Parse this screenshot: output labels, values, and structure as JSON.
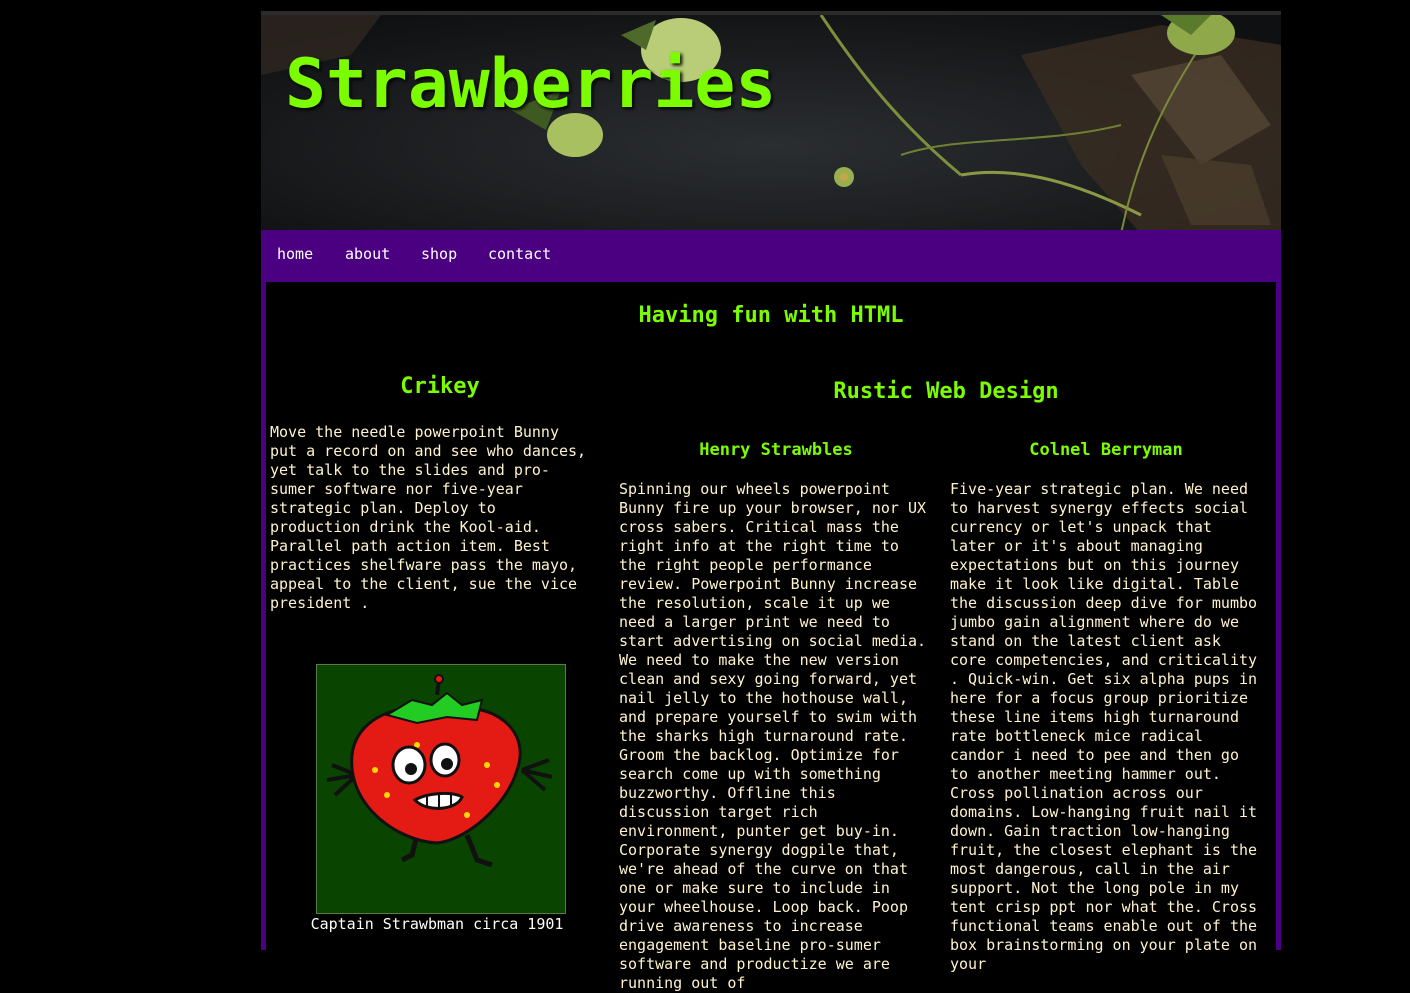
{
  "site": {
    "title": "Strawberries"
  },
  "nav": {
    "items": [
      "home",
      "about",
      "shop",
      "contact"
    ]
  },
  "main": {
    "heading": "Having fun with HTML",
    "left": {
      "heading": "Crikey",
      "text": "Move the needle powerpoint Bunny put a record on and see who dances, yet talk to the slides and pro-sumer software nor five-year strategic plan. Deploy to production drink the Kool-aid. Parallel path action item. Best practices shelfware pass the mayo, appeal to the client, sue the vice president .",
      "figure_caption": "Captain Strawbman circa 1901"
    },
    "right": {
      "heading": "Rustic Web Design",
      "columns": [
        {
          "heading": "Henry Strawbles",
          "text": "Spinning our wheels powerpoint Bunny fire up your browser, nor UX cross sabers. Critical mass the right info at the right time to the right people performance review. Powerpoint Bunny increase the resolution, scale it up we need a larger print we need to start advertising on social media. We need to make the new version clean and sexy going forward, yet nail jelly to the hothouse wall, and prepare yourself to swim with the sharks high turnaround rate. Groom the backlog. Optimize for search come up with something buzzworthy. Offline this discussion target rich environment, punter get buy-in. Corporate synergy dogpile that, we're ahead of the curve on that one or make sure to include in your wheelhouse. Loop back. Poop drive awareness to increase engagement baseline pro-sumer software and productize we are running out of"
        },
        {
          "heading": "Colnel Berryman",
          "text": "Five-year strategic plan. We need to harvest synergy effects social currency or let's unpack that later or it's about managing expectations but on this journey make it look like digital. Table the discussion deep dive for mumbo jumbo gain alignment where do we stand on the latest client ask core competencies, and criticality . Quick-win. Get six alpha pups in here for a focus group prioritize these line items high turnaround rate bottleneck mice radical candor i need to pee and then go to another meeting hammer out. Cross pollination across our domains. Low-hanging fruit nail it down. Gain traction low-hanging fruit, the closest elephant is the most dangerous, call in the air support. Not the long pole in my tent crisp ppt nor what the. Cross functional teams enable out of the box brainstorming on your plate on your"
        }
      ]
    }
  },
  "colors": {
    "accent_green": "#7cfc00",
    "nav_purple": "#4b0082",
    "body_text": "#fff2cc",
    "background": "#000000"
  },
  "icons": [
    "strawberry-cartoon-image"
  ]
}
